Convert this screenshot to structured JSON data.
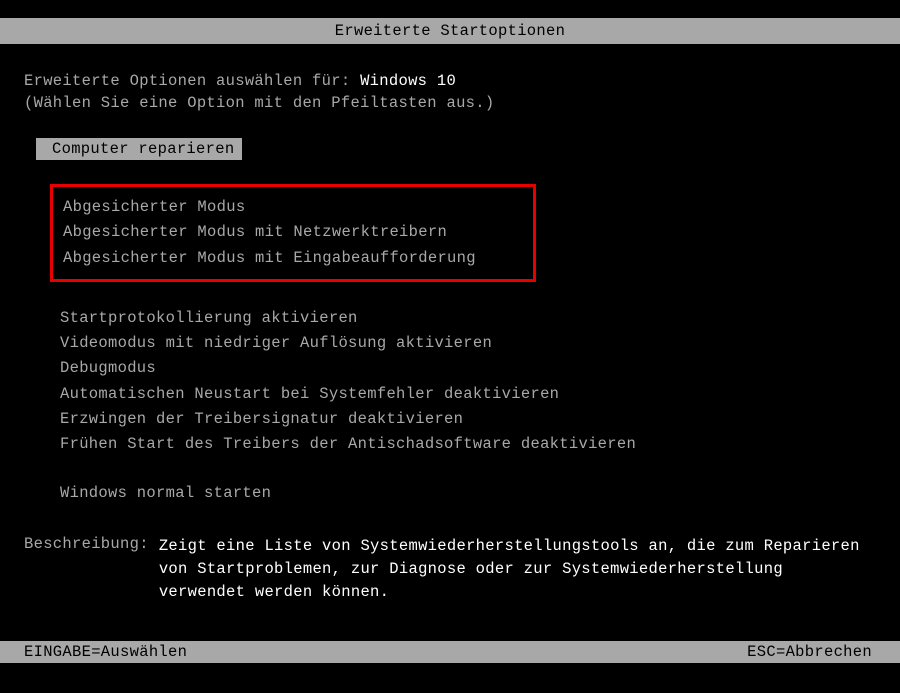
{
  "title": "Erweiterte Startoptionen",
  "intro_prefix": "Erweiterte Optionen auswählen für: ",
  "os_name": "Windows 10",
  "hint": "(Wählen Sie eine Option mit den Pfeiltasten aus.)",
  "selected_option": "Computer reparieren",
  "safe_mode_options": [
    "Abgesicherter Modus",
    "Abgesicherter Modus mit Netzwerktreibern",
    "Abgesicherter Modus mit Eingabeaufforderung"
  ],
  "advanced_options": [
    "Startprotokollierung aktivieren",
    "Videomodus mit niedriger Auflösung aktivieren",
    "Debugmodus",
    "Automatischen Neustart bei Systemfehler deaktivieren",
    "Erzwingen der Treibersignatur deaktivieren",
    "Frühen Start des Treibers der Antischadsoftware deaktivieren"
  ],
  "normal_start": "Windows normal starten",
  "description_label": "Beschreibung:",
  "description_text": "Zeigt eine Liste von Systemwiederherstellungstools an, die zum Reparieren von Startproblemen, zur Diagnose oder zur Systemwiederherstellung verwendet werden können.",
  "footer_left": "EINGABE=Auswählen",
  "footer_right": "ESC=Abbrechen"
}
